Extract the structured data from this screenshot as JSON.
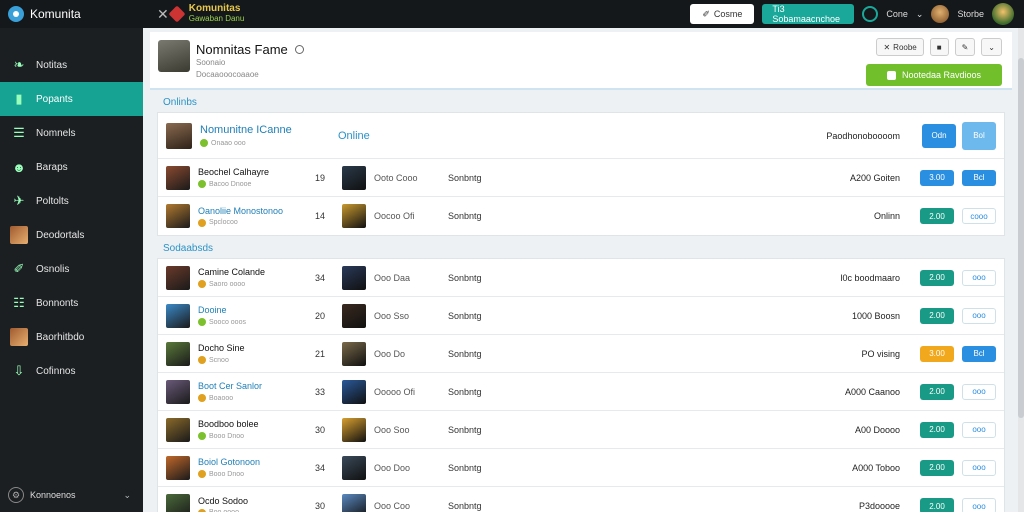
{
  "app": {
    "name": "Komunita"
  },
  "topbar": {
    "center_title": "Komunitas",
    "center_sub": "Gawaban Danu",
    "create_label": "Cosme",
    "primary_label": "Ti3 Sobamaacnchoe",
    "user_label": "Cone",
    "profile_label": "Storbe"
  },
  "sidebar": {
    "items": [
      {
        "label": "Notitas",
        "icon": "leaf-icon"
      },
      {
        "label": "Popants",
        "icon": "chart-icon",
        "active": true
      },
      {
        "label": "Nomnels",
        "icon": "list-icon"
      },
      {
        "label": "Baraps",
        "icon": "group-icon"
      },
      {
        "label": "Poltolts",
        "icon": "bird-icon"
      },
      {
        "label": "Deodortals",
        "icon": "avatar-icon"
      },
      {
        "label": "Osnolis",
        "icon": "wrench-icon"
      },
      {
        "label": "Bonnonts",
        "icon": "doc-icon"
      },
      {
        "label": "Baorhitbdo",
        "icon": "avatar-icon"
      },
      {
        "label": "Cofinnos",
        "icon": "download-icon"
      }
    ],
    "footer_label": "Konnoenos"
  },
  "header": {
    "title": "Nomnitas Fame",
    "subtitle": "Soonaio",
    "subtitle2": "Docaaooocoaaoe",
    "action1": "Roobe",
    "green_button": "Nootedaa Ravdioos"
  },
  "sections": {
    "online_label": "Onlinbs",
    "second_label": "Sodaabsds"
  },
  "featured": {
    "name": "Nomunitne ICanne",
    "sub": "Onaao ooo",
    "status": "Online",
    "right": "Paodhonoboooom",
    "pill": "Odn",
    "action": "Bol"
  },
  "rows_online": [
    {
      "name": "Beochel Calhayre",
      "sub": "Bacoo Dnooe",
      "num": "19",
      "stat": "Ooto Cooo",
      "mode": "Sonbntg",
      "right": "A200 Goiten",
      "pill": "3.00",
      "action": "Bcl",
      "pill_color": "#2a8fe0",
      "act_style": "blue"
    },
    {
      "name": "Oanoliie Monostonoo",
      "sub": "Spclocoo",
      "num": "14",
      "stat": "Oocoo Ofi",
      "mode": "Sonbntg",
      "right": "Onlinn",
      "pill": "2.00",
      "action": "cooo",
      "pill_color": "#199a86",
      "act_style": "ghost"
    }
  ],
  "rows_second": [
    {
      "name": "Camine Colande",
      "sub": "Saoro oooo",
      "num": "34",
      "stat": "Ooo Daa",
      "mode": "Sonbntg",
      "right": "l0c boodmaaro",
      "pill": "2.00",
      "action": "ooo",
      "pill_color": "#199a86",
      "act_style": "ghost"
    },
    {
      "name": "Dooine",
      "sub": "Sooco ooos",
      "num": "20",
      "stat": "Ooo Sso",
      "mode": "Sonbntg",
      "right": "1000 Boosn",
      "pill": "2.00",
      "action": "ooo",
      "pill_color": "#199a86",
      "act_style": "ghost"
    },
    {
      "name": "Docho Sine",
      "sub": "Scnoo",
      "num": "21",
      "stat": "Ooo Do",
      "mode": "Sonbntg",
      "right": "PO vising",
      "pill": "3.00",
      "action": "Bcl",
      "pill_color": "#f2a81c",
      "act_style": "blue"
    },
    {
      "name": "Boot Cer Sanlor",
      "sub": "Boaooo",
      "num": "33",
      "stat": "Ooooo Ofi",
      "mode": "Sonbntg",
      "right": "A000 Caanoo",
      "pill": "2.00",
      "action": "ooo",
      "pill_color": "#199a86",
      "act_style": "ghost"
    },
    {
      "name": "Boodboo bolee",
      "sub": "Booo Dnoo",
      "num": "30",
      "stat": "Ooo Soo",
      "mode": "Sonbntg",
      "right": "A00 Doooo",
      "pill": "2.00",
      "action": "ooo",
      "pill_color": "#199a86",
      "act_style": "ghost"
    },
    {
      "name": "Boiol Gotonoon",
      "sub": "Booo Dnoo",
      "num": "34",
      "stat": "Ooo Doo",
      "mode": "Sonbntg",
      "right": "A000 Toboo",
      "pill": "2.00",
      "action": "ooo",
      "pill_color": "#199a86",
      "act_style": "ghost"
    },
    {
      "name": "Ocdo Sodoo",
      "sub": "Boo oooo",
      "num": "30",
      "stat": "Ooo Coo",
      "mode": "Sonbntg",
      "right": "P3dooooe",
      "pill": "2.00",
      "action": "ooo",
      "pill_color": "#199a86",
      "act_style": "ghost"
    }
  ],
  "colors": {
    "accent": "#17a393",
    "link": "#1f7fb7",
    "green": "#72bf2c"
  }
}
